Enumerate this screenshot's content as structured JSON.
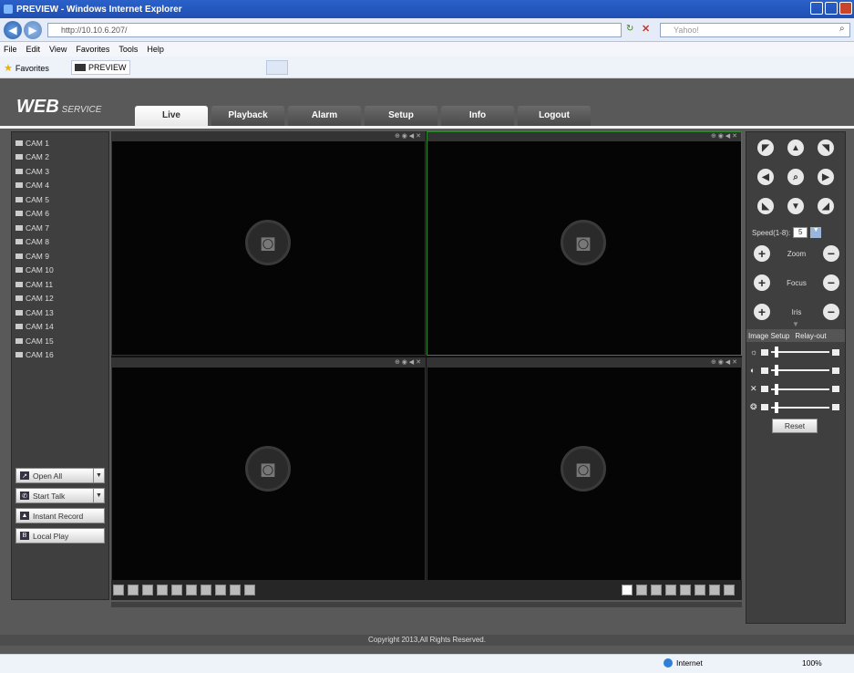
{
  "window": {
    "title": "PREVIEW - Windows Internet Explorer"
  },
  "browser": {
    "url": "http://10.10.6.207/",
    "search_placeholder": "Yahoo!",
    "menu": [
      "File",
      "Edit",
      "View",
      "Favorites",
      "Tools",
      "Help"
    ],
    "favorites_label": "Favorites",
    "tab_label": "PREVIEW",
    "status_zone": "Internet",
    "status_zoom": "100%"
  },
  "app": {
    "logo_main": "WEB",
    "logo_sub": "SERVICE",
    "tabs": [
      "Live",
      "Playback",
      "Alarm",
      "Setup",
      "Info",
      "Logout"
    ],
    "active_tab": "Live",
    "cameras": [
      "CAM 1",
      "CAM 2",
      "CAM 3",
      "CAM 4",
      "CAM 5",
      "CAM 6",
      "CAM 7",
      "CAM 8",
      "CAM 9",
      "CAM 10",
      "CAM 11",
      "CAM 12",
      "CAM 13",
      "CAM 14",
      "CAM 15",
      "CAM 16"
    ],
    "left_buttons": {
      "open_all": "Open All",
      "start_talk": "Start Talk",
      "instant_record": "Instant Record",
      "local_play": "Local Play"
    },
    "ptz": {
      "speed_label": "Speed(1-8):",
      "speed_value": "5",
      "zoom": "Zoom",
      "focus": "Focus",
      "iris": "Iris"
    },
    "image_tabs": [
      "Image Setup",
      "Relay-out"
    ],
    "reset": "Reset",
    "copyright": "Copyright 2013,All Rights Reserved."
  }
}
